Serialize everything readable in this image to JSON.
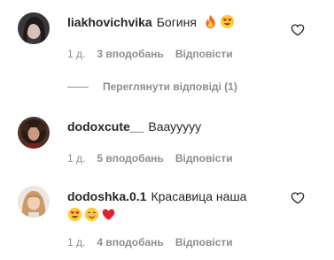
{
  "comments": [
    {
      "username": "liakhovichvika",
      "text": "Богиня",
      "emojis": [
        "fire-emoji",
        "heart-eyes-emoji"
      ],
      "time": "1 д.",
      "likes": "3 вподобань",
      "reply": "Відповісти",
      "avatar": "avatar-dark-hair"
    },
    {
      "username": "dodoxcute__",
      "text": "Вааууууу",
      "emojis": [],
      "time": "1 д.",
      "likes": "5 вподобань",
      "reply": "Відповісти",
      "avatar": "avatar-curly-dark"
    },
    {
      "username": "dodoshka.0.1",
      "text": "Красавица наша",
      "emojis": [
        "heart-eyes-emoji",
        "smiling-emoji",
        "red-heart-emoji"
      ],
      "time": "1 д.",
      "likes": "4 вподобань",
      "reply": "Відповісти",
      "avatar": "avatar-light-hair"
    }
  ],
  "view_replies": "Переглянути відповіді (1)",
  "icons": {
    "like": "heart-outline-icon"
  },
  "colors": {
    "text": "#262626",
    "muted": "#8e8e8e",
    "heart": "#ed4956"
  }
}
